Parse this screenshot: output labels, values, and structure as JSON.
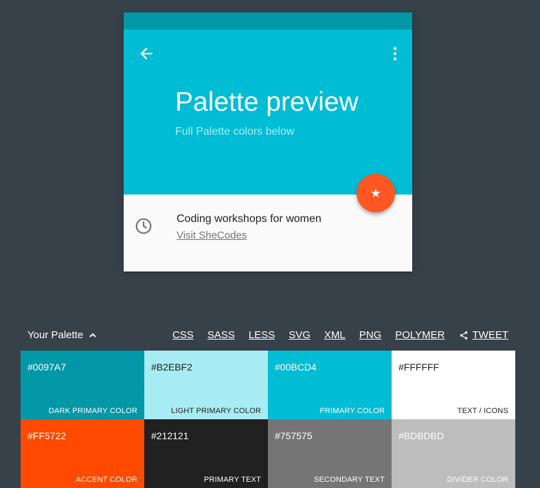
{
  "preview": {
    "title": "Palette preview",
    "subtitle": "Full Palette colors below",
    "event_title": "Coding workshops for women",
    "event_link": "Visit SheCodes"
  },
  "toolbar": {
    "title": "Your Palette",
    "links": [
      "CSS",
      "SASS",
      "LESS",
      "SVG",
      "XML",
      "PNG",
      "POLYMER"
    ],
    "tweet": "TWEET"
  },
  "swatches": [
    {
      "hex": "#0097A7",
      "name": "DARK PRIMARY COLOR",
      "bg": "#0097a7",
      "fg": "#ffffff"
    },
    {
      "hex": "#B2EBF2",
      "name": "LIGHT PRIMARY COLOR",
      "bg": "#a7ecf2",
      "fg": "#212121"
    },
    {
      "hex": "#00BCD4",
      "name": "PRIMARY COLOR",
      "bg": "#00bcd4",
      "fg": "#ffffff"
    },
    {
      "hex": "#FFFFFF",
      "name": "TEXT / ICONS",
      "bg": "#ffffff",
      "fg": "#212121"
    },
    {
      "hex": "#FF5722",
      "name": "ACCENT COLOR",
      "bg": "#ff4a00",
      "fg": "#ffffff"
    },
    {
      "hex": "#212121",
      "name": "PRIMARY TEXT",
      "bg": "#212121",
      "fg": "#ffffff"
    },
    {
      "hex": "#757575",
      "name": "SECONDARY TEXT",
      "bg": "#757575",
      "fg": "#ffffff"
    },
    {
      "hex": "#BDBDBD",
      "name": "DIVIDER COLOR",
      "bg": "#bdbdbd",
      "fg": "#ffffff"
    }
  ],
  "icons": {
    "back": "arrow-back-icon",
    "more": "more-vert-icon",
    "fab": "star-icon",
    "clock": "clock-icon",
    "chevron": "chevron-up-icon",
    "share": "share-icon"
  }
}
